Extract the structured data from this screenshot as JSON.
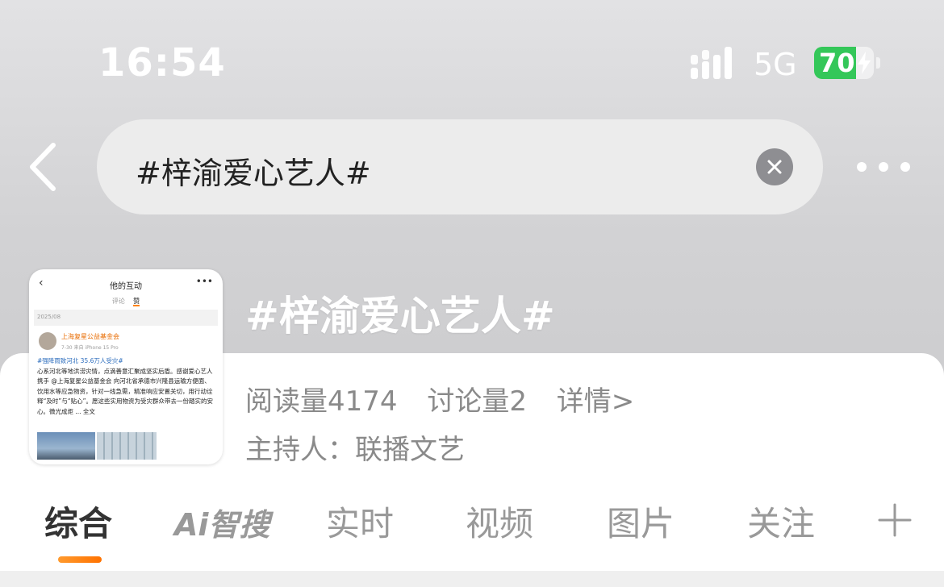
{
  "status_bar": {
    "time": "16:54",
    "network": "5G",
    "battery": "70"
  },
  "search": {
    "query": "#梓渝爱心艺人#"
  },
  "topic": {
    "title": "#梓渝爱心艺人#",
    "read_count": "阅读量4174",
    "discussion_count": "讨论量2",
    "details_link": "详情>",
    "host": "主持人：联播文艺"
  },
  "thumbnail": {
    "title": "他的互动",
    "tabs": [
      "评论",
      "赞"
    ],
    "date": "2025/08",
    "author": "上海复星公益基金会",
    "meta": "7-30  来自 iPhone 15 Pro",
    "hashtag": "#强降雨致河北 35.6万人受灾#",
    "body": "心系河北等地洪涝灾情，点滴善意汇聚成坚实后盾。感谢爱心艺人携手 @上海复星公益基金会 向河北省承德市兴隆县运输方便面、饮用水等应急物资，针对一线急需，精准响应安置关切，用行动诠释“及时”与“贴心”。愿这些实用物资为受灾群众带去一份踏实的安心。微光成炬 ... 全文"
  },
  "tabs": {
    "items": [
      "综合",
      "实时",
      "视频",
      "图片",
      "关注"
    ],
    "ai_label": "Ai智搜",
    "active": "综合"
  },
  "colors": {
    "accent": "#ff8200",
    "battery": "#34c759",
    "tab_inactive": "#999999",
    "tab_active": "#333333"
  },
  "icons": [
    "signal-icon",
    "battery-icon",
    "back-chevron-icon",
    "clear-icon",
    "more-icon",
    "plus-icon"
  ]
}
